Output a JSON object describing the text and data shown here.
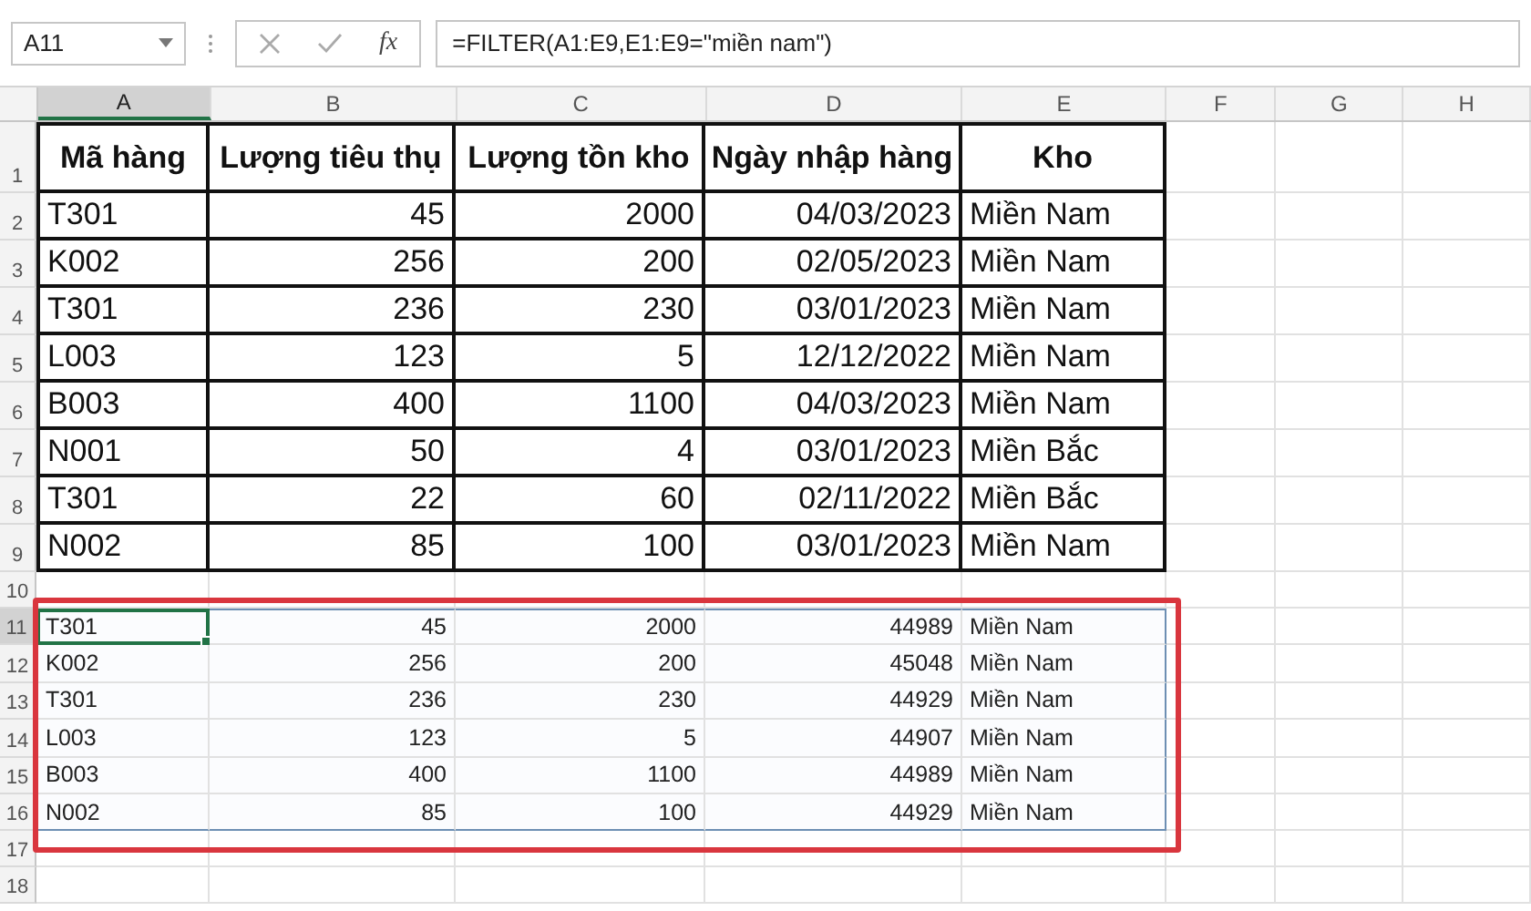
{
  "name_box": "A11",
  "function_button": "fx",
  "formula": "=FILTER(A1:E9,E1:E9=\"miền nam\")",
  "columns": [
    {
      "label": "A",
      "selected": true
    },
    {
      "label": "B",
      "selected": false
    },
    {
      "label": "C",
      "selected": false
    },
    {
      "label": "D",
      "selected": false
    },
    {
      "label": "E",
      "selected": false
    },
    {
      "label": "F",
      "selected": false
    },
    {
      "label": "G",
      "selected": false
    },
    {
      "label": "H",
      "selected": false
    }
  ],
  "rows": [
    {
      "number": "1",
      "selected": false,
      "kind": "header",
      "cells": [
        "Mã hàng",
        "Lượng tiêu thụ",
        "Lượng tồn kho",
        "Ngày nhập hàng",
        "Kho"
      ]
    },
    {
      "number": "2",
      "selected": false,
      "kind": "table",
      "cells": [
        "T301",
        "45",
        "2000",
        "04/03/2023",
        "Miền Nam"
      ]
    },
    {
      "number": "3",
      "selected": false,
      "kind": "table",
      "cells": [
        "K002",
        "256",
        "200",
        "02/05/2023",
        "Miền Nam"
      ]
    },
    {
      "number": "4",
      "selected": false,
      "kind": "table",
      "cells": [
        "T301",
        "236",
        "230",
        "03/01/2023",
        "Miền Nam"
      ]
    },
    {
      "number": "5",
      "selected": false,
      "kind": "table",
      "cells": [
        "L003",
        "123",
        "5",
        "12/12/2022",
        "Miền Nam"
      ]
    },
    {
      "number": "6",
      "selected": false,
      "kind": "table",
      "cells": [
        "B003",
        "400",
        "1100",
        "04/03/2023",
        "Miền Nam"
      ]
    },
    {
      "number": "7",
      "selected": false,
      "kind": "table",
      "cells": [
        "N001",
        "50",
        "4",
        "03/01/2023",
        "Miền Bắc"
      ]
    },
    {
      "number": "8",
      "selected": false,
      "kind": "table",
      "cells": [
        "T301",
        "22",
        "60",
        "02/11/2022",
        "Miền Bắc"
      ]
    },
    {
      "number": "9",
      "selected": false,
      "kind": "table",
      "cells": [
        "N002",
        "85",
        "100",
        "03/01/2023",
        "Miền Nam"
      ]
    },
    {
      "number": "10",
      "selected": false,
      "kind": "blank",
      "cells": []
    },
    {
      "number": "11",
      "selected": true,
      "kind": "result",
      "cells": [
        "T301",
        "45",
        "2000",
        "44989",
        "Miền Nam"
      ]
    },
    {
      "number": "12",
      "selected": false,
      "kind": "result",
      "cells": [
        "K002",
        "256",
        "200",
        "45048",
        "Miền Nam"
      ]
    },
    {
      "number": "13",
      "selected": false,
      "kind": "result",
      "cells": [
        "T301",
        "236",
        "230",
        "44929",
        "Miền Nam"
      ]
    },
    {
      "number": "14",
      "selected": false,
      "kind": "result",
      "cells": [
        "L003",
        "123",
        "5",
        "44907",
        "Miền Nam"
      ]
    },
    {
      "number": "15",
      "selected": false,
      "kind": "result",
      "cells": [
        "B003",
        "400",
        "1100",
        "44989",
        "Miền Nam"
      ]
    },
    {
      "number": "16",
      "selected": false,
      "kind": "result",
      "cells": [
        "N002",
        "85",
        "100",
        "44929",
        "Miền Nam"
      ]
    },
    {
      "number": "17",
      "selected": false,
      "kind": "blank",
      "cells": []
    },
    {
      "number": "18",
      "selected": false,
      "kind": "blank",
      "cells": []
    }
  ]
}
